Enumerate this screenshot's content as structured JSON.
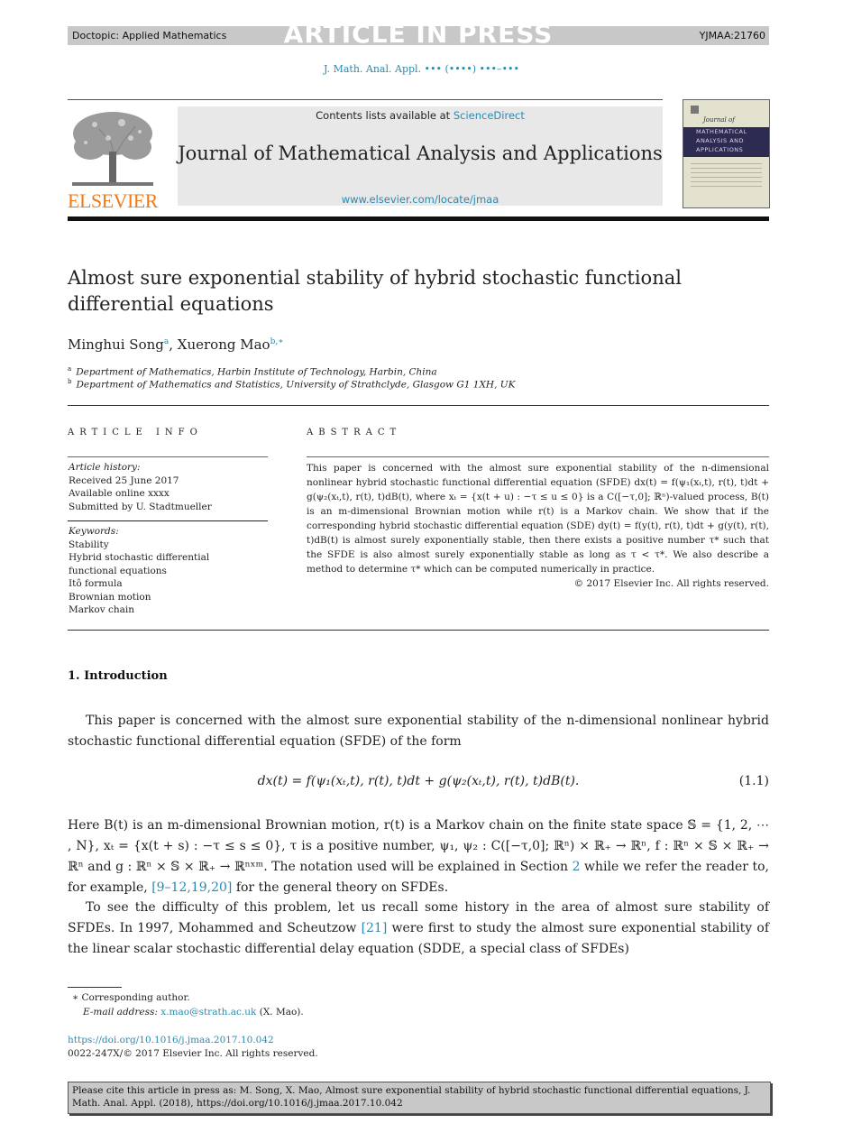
{
  "topbar": {
    "doctopic": "Doctopic: Applied Mathematics",
    "banner": "ARTICLE IN PRESS",
    "code": "YJMAA:21760"
  },
  "journal_ref": "J. Math. Anal. Appl. ••• (••••) •••–•••",
  "masthead": {
    "contents_prefix": "Contents lists available at ",
    "contents_link": "ScienceDirect",
    "journal_title": "Journal of Mathematical Analysis and Applications",
    "url": "www.elsevier.com/locate/jmaa",
    "publisher_logo": "ELSEVIER",
    "cover": {
      "script_title": "Journal of",
      "lines": [
        "MATHEMATICAL",
        "ANALYSIS AND",
        "APPLICATIONS"
      ]
    }
  },
  "article": {
    "title": "Almost sure exponential stability of hybrid stochastic functional differential equations",
    "authors": [
      {
        "name": "Minghui Song",
        "marks": "a"
      },
      {
        "name": "Xuerong Mao",
        "marks": "b,∗"
      }
    ],
    "affiliations": [
      {
        "mark": "a",
        "text": "Department of Mathematics, Harbin Institute of Technology, Harbin, China"
      },
      {
        "mark": "b",
        "text": "Department of Mathematics and Statistics, University of Strathclyde, Glasgow G1 1XH, UK"
      }
    ]
  },
  "article_info": {
    "heading": "ARTICLE INFO",
    "history_label": "Article history:",
    "history": [
      "Received 25 June 2017",
      "Available online xxxx",
      "Submitted by U. Stadtmueller"
    ],
    "keywords_label": "Keywords:",
    "keywords": [
      "Stability",
      "Hybrid stochastic differential",
      "functional equations",
      "Itô formula",
      "Brownian motion",
      "Markov chain"
    ]
  },
  "abstract": {
    "heading": "ABSTRACT",
    "text": "This paper is concerned with the almost sure exponential stability of the n-dimensional nonlinear hybrid stochastic functional differential equation (SFDE) dx(t) = f(ψ₁(xₜ,t), r(t), t)dt + g(ψ₂(xₜ,t), r(t), t)dB(t), where xₜ = {x(t + u) : −τ ≤ u ≤ 0} is a C([−τ,0]; ℝⁿ)-valued process, B(t) is an m-dimensional Brownian motion while r(t) is a Markov chain. We show that if the corresponding hybrid stochastic differential equation (SDE) dy(t) = f(y(t), r(t), t)dt + g(y(t), r(t), t)dB(t) is almost surely exponentially stable, then there exists a positive number τ* such that the SFDE is also almost surely exponentially stable as long as τ < τ*. We also describe a method to determine τ* which can be computed numerically in practice.",
    "copyright": "© 2017 Elsevier Inc. All rights reserved."
  },
  "body": {
    "section_heading": "1. Introduction",
    "p1": "This paper is concerned with the almost sure exponential stability of the n-dimensional nonlinear hybrid stochastic functional differential equation (SFDE) of the form",
    "equation": "dx(t) = f(ψ₁(xₜ,t), r(t), t)dt + g(ψ₂(xₜ,t), r(t), t)dB(t).",
    "equation_number": "(1.1)",
    "p2_a": "Here B(t) is an m-dimensional Brownian motion, r(t) is a Markov chain on the finite state space 𝕊 = {1, 2, ⋯ , N}, xₜ = {x(t + s) : −τ ≤ s ≤ 0}, τ is a positive number, ψ₁, ψ₂ : C([−τ,0]; ℝⁿ) × ℝ₊ → ℝⁿ, f : ℝⁿ × 𝕊 × ℝ₊ → ℝⁿ and g : ℝⁿ × 𝕊 × ℝ₊ → ℝⁿˣᵐ. The notation used will be explained in Section ",
    "p2_link1": "2",
    "p2_b": " while we refer the reader to, for example, ",
    "p2_link2": "[9–12,19,20]",
    "p2_c": " for the general theory on SFDEs.",
    "p3_a": "To see the difficulty of this problem, let us recall some history in the area of almost sure stability of SFDEs. In 1997, Mohammed and Scheutzow ",
    "p3_link": "[21]",
    "p3_b": " were first to study the almost sure exponential stability of the linear scalar stochastic differential delay equation (SDDE, a special class of SFDEs)"
  },
  "footnotes": {
    "corresponding": "∗  Corresponding author.",
    "email_label": "E-mail address:",
    "email": "x.mao@strath.ac.uk",
    "email_suffix": " (X. Mao).",
    "doi": "https://doi.org/10.1016/j.jmaa.2017.10.042",
    "issn": "0022-247X/© 2017 Elsevier Inc. All rights reserved."
  },
  "cite_box": "Please cite this article in press as: M. Song, X. Mao, Almost sure exponential stability of hybrid stochastic functional differential equations, J. Math. Anal. Appl. (2018), https://doi.org/10.1016/j.jmaa.2017.10.042",
  "colors": {
    "link": "#2a8ab0",
    "elsevier_orange": "#f07a1a",
    "banner_gray": "#c8c8c8",
    "cover_band": "#2e2b52"
  }
}
